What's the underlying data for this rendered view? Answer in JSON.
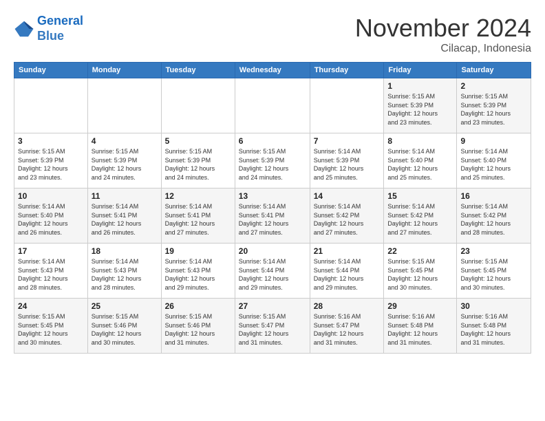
{
  "header": {
    "logo_line1": "General",
    "logo_line2": "Blue",
    "month": "November 2024",
    "location": "Cilacap, Indonesia"
  },
  "weekdays": [
    "Sunday",
    "Monday",
    "Tuesday",
    "Wednesday",
    "Thursday",
    "Friday",
    "Saturday"
  ],
  "weeks": [
    [
      {
        "day": "",
        "info": ""
      },
      {
        "day": "",
        "info": ""
      },
      {
        "day": "",
        "info": ""
      },
      {
        "day": "",
        "info": ""
      },
      {
        "day": "",
        "info": ""
      },
      {
        "day": "1",
        "info": "Sunrise: 5:15 AM\nSunset: 5:39 PM\nDaylight: 12 hours\nand 23 minutes."
      },
      {
        "day": "2",
        "info": "Sunrise: 5:15 AM\nSunset: 5:39 PM\nDaylight: 12 hours\nand 23 minutes."
      }
    ],
    [
      {
        "day": "3",
        "info": "Sunrise: 5:15 AM\nSunset: 5:39 PM\nDaylight: 12 hours\nand 23 minutes."
      },
      {
        "day": "4",
        "info": "Sunrise: 5:15 AM\nSunset: 5:39 PM\nDaylight: 12 hours\nand 24 minutes."
      },
      {
        "day": "5",
        "info": "Sunrise: 5:15 AM\nSunset: 5:39 PM\nDaylight: 12 hours\nand 24 minutes."
      },
      {
        "day": "6",
        "info": "Sunrise: 5:15 AM\nSunset: 5:39 PM\nDaylight: 12 hours\nand 24 minutes."
      },
      {
        "day": "7",
        "info": "Sunrise: 5:14 AM\nSunset: 5:39 PM\nDaylight: 12 hours\nand 25 minutes."
      },
      {
        "day": "8",
        "info": "Sunrise: 5:14 AM\nSunset: 5:40 PM\nDaylight: 12 hours\nand 25 minutes."
      },
      {
        "day": "9",
        "info": "Sunrise: 5:14 AM\nSunset: 5:40 PM\nDaylight: 12 hours\nand 25 minutes."
      }
    ],
    [
      {
        "day": "10",
        "info": "Sunrise: 5:14 AM\nSunset: 5:40 PM\nDaylight: 12 hours\nand 26 minutes."
      },
      {
        "day": "11",
        "info": "Sunrise: 5:14 AM\nSunset: 5:41 PM\nDaylight: 12 hours\nand 26 minutes."
      },
      {
        "day": "12",
        "info": "Sunrise: 5:14 AM\nSunset: 5:41 PM\nDaylight: 12 hours\nand 27 minutes."
      },
      {
        "day": "13",
        "info": "Sunrise: 5:14 AM\nSunset: 5:41 PM\nDaylight: 12 hours\nand 27 minutes."
      },
      {
        "day": "14",
        "info": "Sunrise: 5:14 AM\nSunset: 5:42 PM\nDaylight: 12 hours\nand 27 minutes."
      },
      {
        "day": "15",
        "info": "Sunrise: 5:14 AM\nSunset: 5:42 PM\nDaylight: 12 hours\nand 27 minutes."
      },
      {
        "day": "16",
        "info": "Sunrise: 5:14 AM\nSunset: 5:42 PM\nDaylight: 12 hours\nand 28 minutes."
      }
    ],
    [
      {
        "day": "17",
        "info": "Sunrise: 5:14 AM\nSunset: 5:43 PM\nDaylight: 12 hours\nand 28 minutes."
      },
      {
        "day": "18",
        "info": "Sunrise: 5:14 AM\nSunset: 5:43 PM\nDaylight: 12 hours\nand 28 minutes."
      },
      {
        "day": "19",
        "info": "Sunrise: 5:14 AM\nSunset: 5:43 PM\nDaylight: 12 hours\nand 29 minutes."
      },
      {
        "day": "20",
        "info": "Sunrise: 5:14 AM\nSunset: 5:44 PM\nDaylight: 12 hours\nand 29 minutes."
      },
      {
        "day": "21",
        "info": "Sunrise: 5:14 AM\nSunset: 5:44 PM\nDaylight: 12 hours\nand 29 minutes."
      },
      {
        "day": "22",
        "info": "Sunrise: 5:15 AM\nSunset: 5:45 PM\nDaylight: 12 hours\nand 30 minutes."
      },
      {
        "day": "23",
        "info": "Sunrise: 5:15 AM\nSunset: 5:45 PM\nDaylight: 12 hours\nand 30 minutes."
      }
    ],
    [
      {
        "day": "24",
        "info": "Sunrise: 5:15 AM\nSunset: 5:45 PM\nDaylight: 12 hours\nand 30 minutes."
      },
      {
        "day": "25",
        "info": "Sunrise: 5:15 AM\nSunset: 5:46 PM\nDaylight: 12 hours\nand 30 minutes."
      },
      {
        "day": "26",
        "info": "Sunrise: 5:15 AM\nSunset: 5:46 PM\nDaylight: 12 hours\nand 31 minutes."
      },
      {
        "day": "27",
        "info": "Sunrise: 5:15 AM\nSunset: 5:47 PM\nDaylight: 12 hours\nand 31 minutes."
      },
      {
        "day": "28",
        "info": "Sunrise: 5:16 AM\nSunset: 5:47 PM\nDaylight: 12 hours\nand 31 minutes."
      },
      {
        "day": "29",
        "info": "Sunrise: 5:16 AM\nSunset: 5:48 PM\nDaylight: 12 hours\nand 31 minutes."
      },
      {
        "day": "30",
        "info": "Sunrise: 5:16 AM\nSunset: 5:48 PM\nDaylight: 12 hours\nand 31 minutes."
      }
    ]
  ]
}
